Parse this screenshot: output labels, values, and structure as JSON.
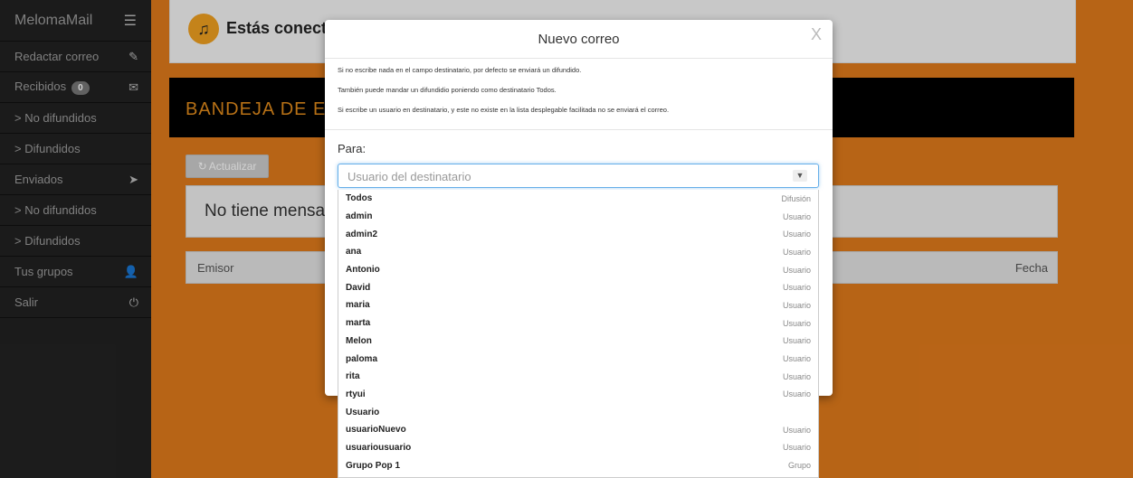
{
  "sidebar": {
    "brand": "MelomaMail",
    "items": [
      {
        "label": "Redactar correo",
        "icon": "✎"
      },
      {
        "label": "Recibidos",
        "badge": "0",
        "icon": "✉"
      },
      {
        "label": "> No difundidos",
        "icon": ""
      },
      {
        "label": "> Difundidos",
        "icon": ""
      },
      {
        "label": "Enviados",
        "icon": "➤"
      },
      {
        "label": "> No difundidos",
        "icon": ""
      },
      {
        "label": "> Difundidos",
        "icon": ""
      },
      {
        "label": "Tus grupos",
        "icon": "👤"
      },
      {
        "label": "Salir",
        "icon": "⏻"
      }
    ]
  },
  "main": {
    "connected_text": "Estás conect",
    "inbox_title": "BANDEJA DE E",
    "refresh_label": "Actualizar",
    "no_messages": "No tiene mensa",
    "col_sender": "Emisor",
    "col_date": "Fecha"
  },
  "modal": {
    "title": "Nuevo correo",
    "close": "X",
    "info": [
      "Si no escribe nada en el campo destinatario, por defecto se enviará un difundido.",
      "También puede mandar un difundidio poniendo como destinatario Todos.",
      "Si escribe un usuario en destinatario, y este no existe en la lista desplegable facilitada no se enviará el correo."
    ],
    "to_label": "Para:",
    "to_placeholder": "Usuario del destinatario"
  },
  "dropdown": [
    {
      "name": "Todos",
      "kind": "Difusión"
    },
    {
      "name": "admin",
      "kind": "Usuario"
    },
    {
      "name": "admin2",
      "kind": "Usuario"
    },
    {
      "name": "ana",
      "kind": "Usuario"
    },
    {
      "name": "Antonio",
      "kind": "Usuario"
    },
    {
      "name": "David",
      "kind": "Usuario"
    },
    {
      "name": "maria",
      "kind": "Usuario"
    },
    {
      "name": "marta",
      "kind": "Usuario"
    },
    {
      "name": "Melon",
      "kind": "Usuario"
    },
    {
      "name": "paloma",
      "kind": "Usuario"
    },
    {
      "name": "rita",
      "kind": "Usuario"
    },
    {
      "name": "rtyui",
      "kind": "Usuario"
    },
    {
      "name": "Usuario",
      "kind": ""
    },
    {
      "name": "usuarioNuevo",
      "kind": "Usuario"
    },
    {
      "name": "usuariousuario",
      "kind": "Usuario"
    },
    {
      "name": "Grupo Pop 1",
      "kind": "Grupo"
    }
  ]
}
